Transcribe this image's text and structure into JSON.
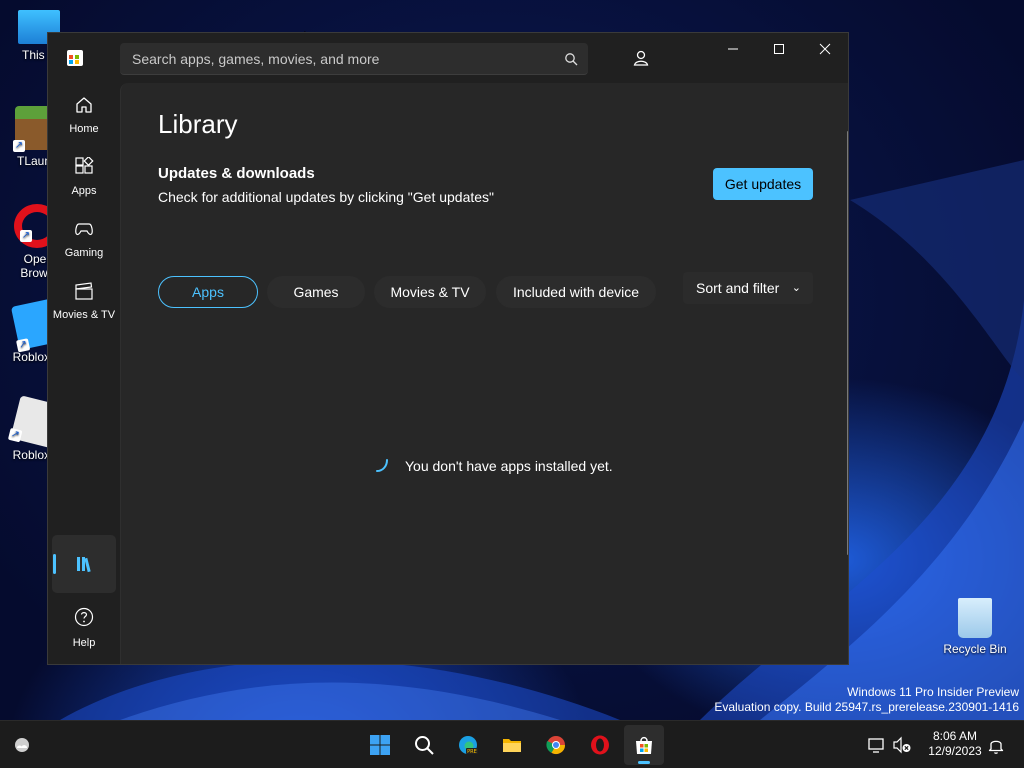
{
  "desktop": {
    "icons": [
      {
        "label": "This P"
      },
      {
        "label": "TLaunc"
      },
      {
        "label": "Oper\nBrows"
      },
      {
        "label": "Roblox S"
      },
      {
        "label": "Roblox P"
      },
      {
        "label": "Recycle Bin"
      }
    ],
    "watermark": {
      "line1": "Windows 11 Pro Insider Preview",
      "line2": "Evaluation copy. Build 25947.rs_prerelease.230901-1416"
    }
  },
  "store": {
    "search": {
      "placeholder": "Search apps, games, movies, and more"
    },
    "nav": {
      "home": "Home",
      "apps": "Apps",
      "gaming": "Gaming",
      "movies": "Movies & TV",
      "help": "Help"
    },
    "page_title": "Library",
    "updates": {
      "heading": "Updates & downloads",
      "description": "Check for additional updates by clicking \"Get updates\"",
      "button": "Get updates"
    },
    "filters": {
      "apps": "Apps",
      "games": "Games",
      "movies": "Movies & TV",
      "included": "Included with device",
      "selected": "Apps"
    },
    "sort_filter": "Sort and filter",
    "empty_message": "You don't have apps installed yet.",
    "accent_color": "#4cc2ff"
  },
  "taskbar": {
    "apps": [
      "start",
      "search",
      "edge-pre",
      "file-explorer",
      "chrome",
      "opera",
      "microsoft-store"
    ],
    "active": "microsoft-store",
    "time": "8:06 AM",
    "date": "12/9/2023"
  }
}
